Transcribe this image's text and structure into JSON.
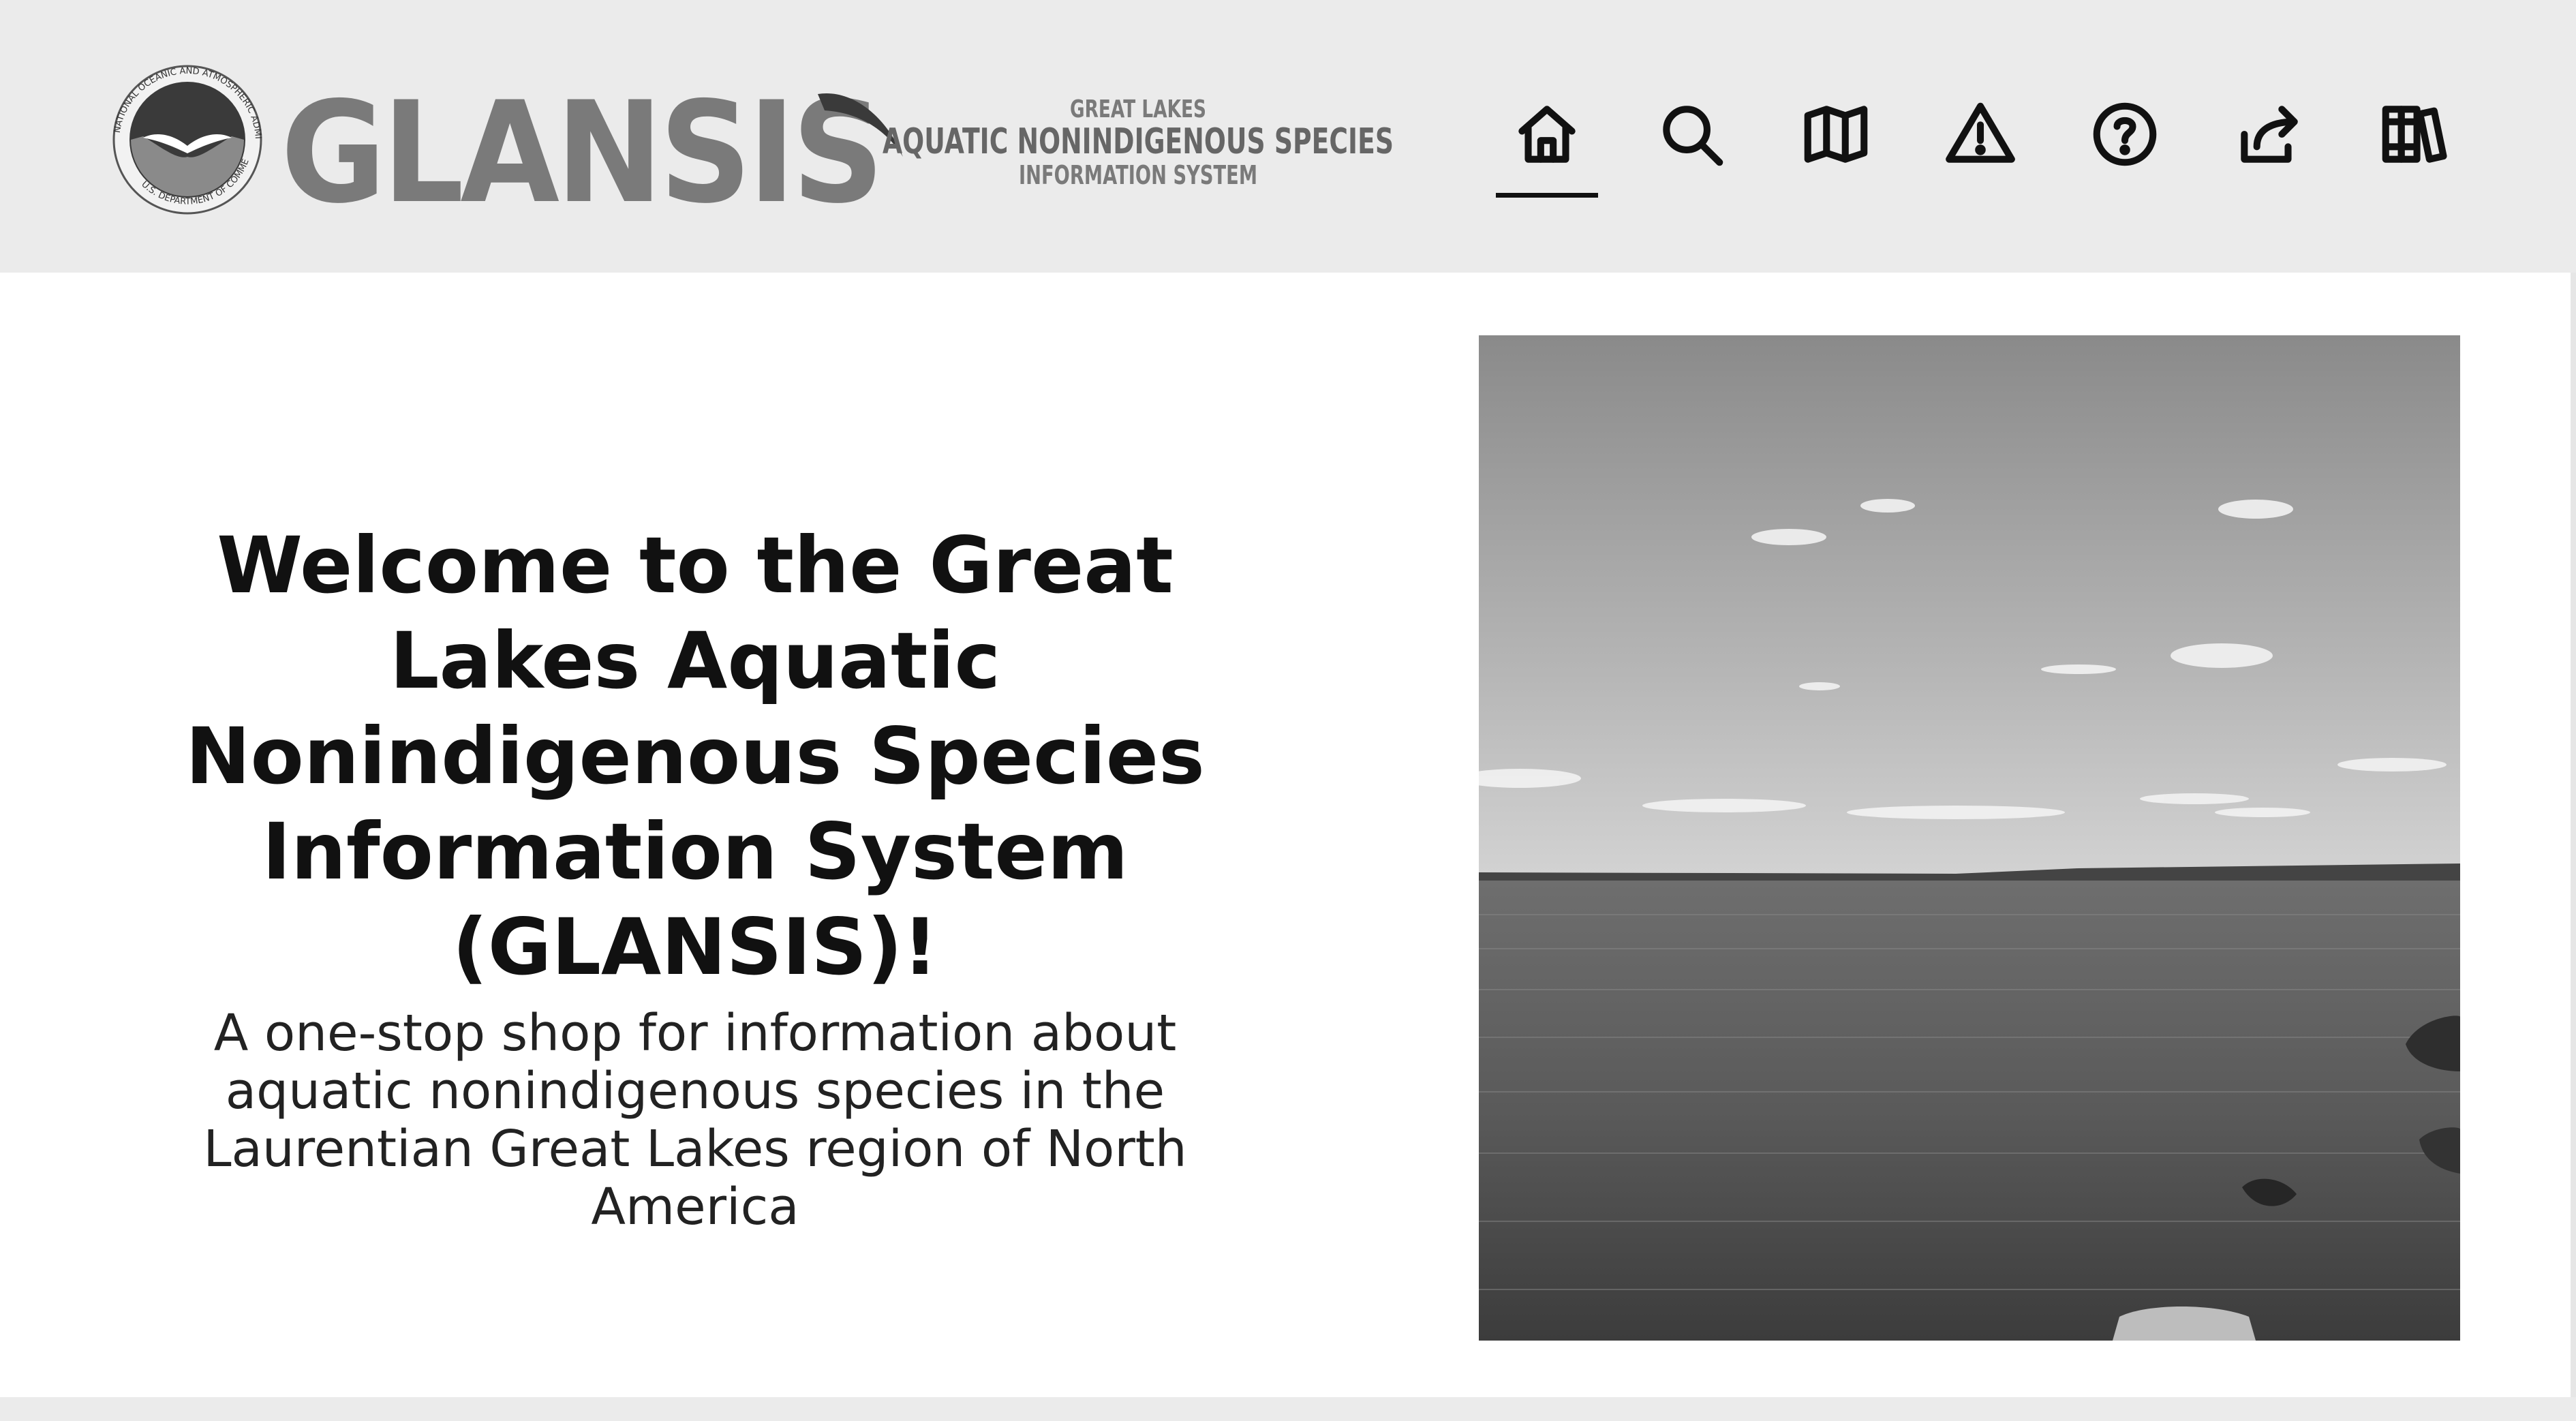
{
  "header": {
    "logo": {
      "brand": "GLANSIS",
      "tagline_top": "GREAT LAKES",
      "tagline_middle": "AQUATIC NONINDIGENOUS SPECIES",
      "tagline_bottom": "INFORMATION SYSTEM",
      "seal_text_top": "NATIONAL OCEANIC AND ATMOSPHERIC ADMINISTRATION",
      "seal_text_bottom": "U.S. DEPARTMENT OF COMMERCE"
    },
    "nav": [
      {
        "icon": "home-icon",
        "active": true
      },
      {
        "icon": "search-icon",
        "active": false
      },
      {
        "icon": "map-icon",
        "active": false
      },
      {
        "icon": "warning-icon",
        "active": false
      },
      {
        "icon": "help-icon",
        "active": false
      },
      {
        "icon": "share-icon",
        "active": false
      },
      {
        "icon": "books-icon",
        "active": false
      }
    ]
  },
  "hero": {
    "title": "Welcome to the Great Lakes Aquatic Nonindigenous Species Information System (GLANSIS)!",
    "subtitle": "A one-stop shop for information about aquatic nonindigenous species in the Laurentian Great Lakes region of North America",
    "image": "lake-photo"
  },
  "colors": {
    "header_bg": "#ebebeb",
    "text": "#111111",
    "logo_gray": "#7a7a7a"
  }
}
